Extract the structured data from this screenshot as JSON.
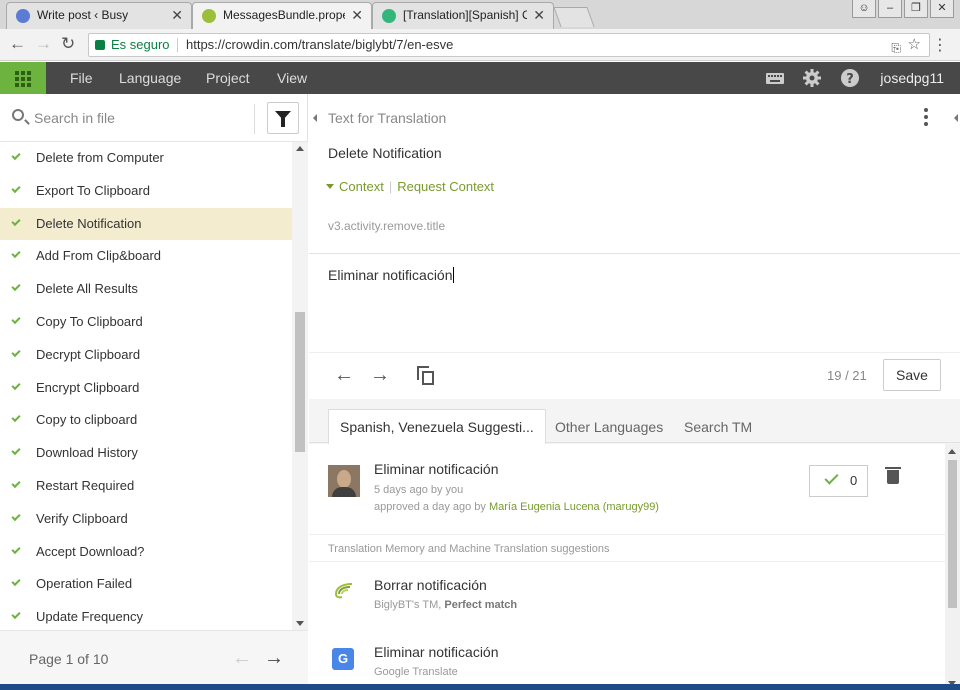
{
  "browser": {
    "tabs": [
      {
        "title": "Write post ‹ Busy",
        "color": "#5b7bd5"
      },
      {
        "title": "MessagesBundle.properti",
        "color": "#9cbf3b"
      },
      {
        "title": "[Translation][Spanish] Or",
        "color": "#33b679"
      }
    ],
    "secure_label": "Es seguro",
    "url": "https://crowdin.com/translate/biglybt/7/en-esve"
  },
  "header": {
    "menu": [
      "File",
      "Language",
      "Project",
      "View"
    ],
    "username": "josedpg11"
  },
  "sidebar": {
    "search_placeholder": "Search in file",
    "strings": [
      {
        "label": "Delete from Computer",
        "selected": false
      },
      {
        "label": "Export To Clipboard",
        "selected": false
      },
      {
        "label": "Delete Notification",
        "selected": true
      },
      {
        "label": "Add From Clip&board",
        "selected": false
      },
      {
        "label": "Delete All Results",
        "selected": false
      },
      {
        "label": "Copy To Clipboard",
        "selected": false
      },
      {
        "label": "Decrypt Clipboard",
        "selected": false
      },
      {
        "label": "Encrypt Clipboard",
        "selected": false
      },
      {
        "label": "Copy to clipboard",
        "selected": false
      },
      {
        "label": "Download History",
        "selected": false
      },
      {
        "label": "Restart Required",
        "selected": false
      },
      {
        "label": "Verify Clipboard",
        "selected": false
      },
      {
        "label": "Accept Download?",
        "selected": false
      },
      {
        "label": "Operation Failed",
        "selected": false
      },
      {
        "label": "Update Frequency",
        "selected": false
      }
    ],
    "pager": "Page 1 of 10"
  },
  "editor": {
    "section_title": "Text for Translation",
    "source_text": "Delete Notification",
    "context_link": "Context",
    "request_context": "Request Context",
    "identifier": "v3.activity.remove.title",
    "translation_value": "Eliminar notificación",
    "counter": "19 / 21",
    "save_label": "Save"
  },
  "suggestions": {
    "tabs": [
      "Spanish, Venezuela Suggesti...",
      "Other Languages",
      "Search TM"
    ],
    "user": {
      "text": "Eliminar notificación",
      "time": "5 days ago by you",
      "approved_prefix": "approved a day ago by",
      "approved_by": "María Eugenia Lucena (marugy99)",
      "votes": "0"
    },
    "tm_section_label": "Translation Memory and Machine Translation suggestions",
    "tm": [
      {
        "text": "Borrar notificación",
        "source": "BiglyBT's TM,",
        "match": "Perfect match"
      },
      {
        "text": "Eliminar notificación",
        "source": "Google Translate"
      }
    ]
  }
}
